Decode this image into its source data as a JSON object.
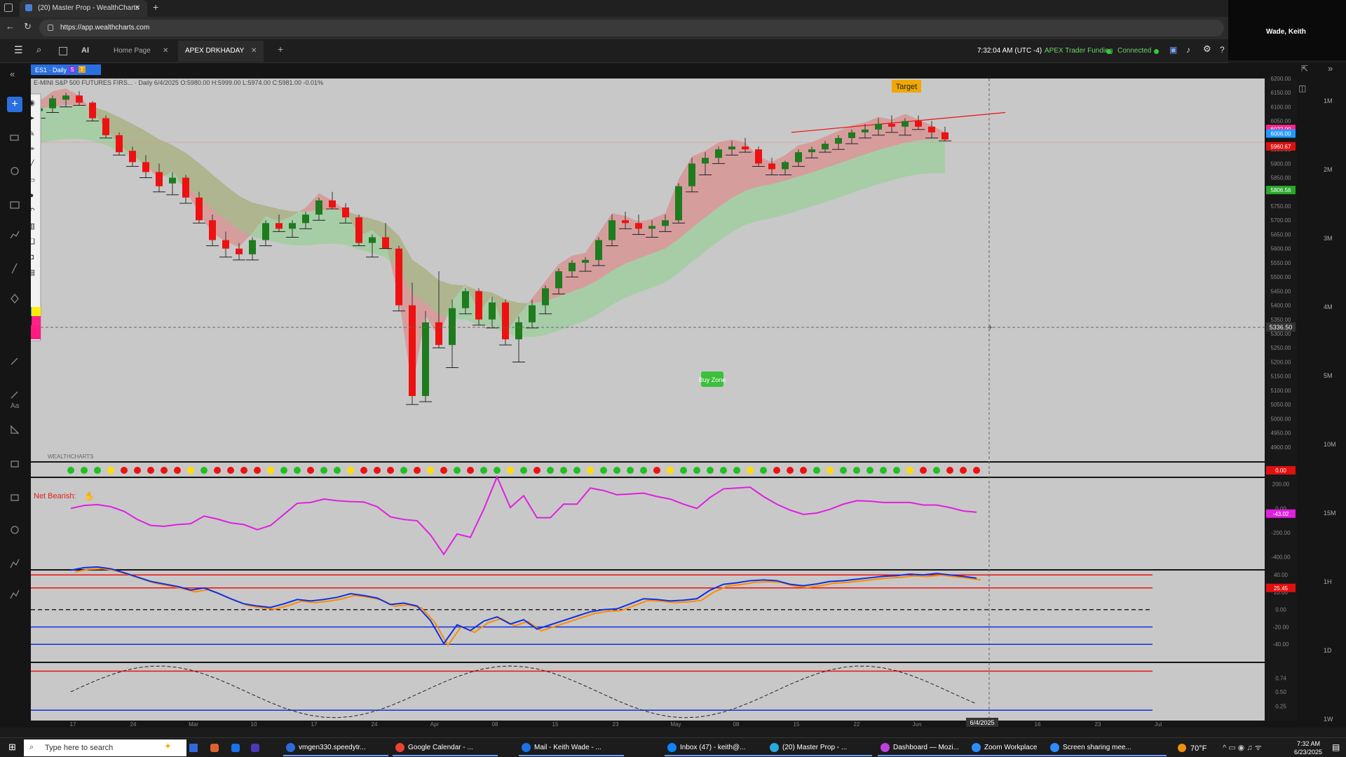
{
  "browser": {
    "tab_title": "(20) Master Prop - WealthCharts",
    "url": "https://app.wealthcharts.com",
    "new_tab": "+",
    "close": "✕"
  },
  "user": {
    "name": "Wade, Keith"
  },
  "app": {
    "tabs": [
      {
        "label": "Home Page"
      },
      {
        "label": "APEX DRKHADAY"
      }
    ],
    "add_tab": "+",
    "ai_label": "AI",
    "clock": "7:32:04 AM  (UTC -4)",
    "account": "APEX Trader Funding",
    "status": "Connected"
  },
  "chart": {
    "symbol_badge": "ES1 · Daily",
    "symbol_badge_items": [
      "S",
      "T"
    ],
    "ohlc_line": "E-MINI S&P 500 FUTURES FIRS... · Daily 6/4/2025 O:5980.00 H:5999.00 L:5974.00 C:5981.00 -0.01%",
    "target_label": "Target",
    "buy_zone_label": "Buy Zone",
    "watermark": "WEALTHCHARTS",
    "net_bearish_label": "Net Bearish:",
    "crosshair_date": "6/4/2025",
    "crosshair_price": "5336.50"
  },
  "chart_data": {
    "type": "candlestick",
    "ylim": [
      4850,
      6200
    ],
    "y_ticks": [
      6200,
      6150,
      6100,
      6050,
      6000,
      5950,
      5900,
      5850,
      5800,
      5750,
      5700,
      5650,
      5600,
      5550,
      5500,
      5450,
      5400,
      5350,
      5300,
      5250,
      5200,
      5150,
      5100,
      5050,
      5000,
      4950,
      4900
    ],
    "x_tick_labels": [
      "17",
      "24",
      "Mar",
      "10",
      "17",
      "24",
      "Apr",
      "08",
      "15",
      "23",
      "May",
      "08",
      "15",
      "22",
      "Jun",
      "09",
      "16",
      "23",
      "Jul"
    ],
    "price_labels": [
      {
        "value": "6022.00"
      },
      {
        "value": "6006.00"
      },
      {
        "value": "5960.67"
      },
      {
        "value": "5806.56"
      }
    ],
    "candles": [
      [
        6085,
        6110,
        6060,
        6095
      ],
      [
        6095,
        6140,
        6080,
        6130
      ],
      [
        6125,
        6150,
        6100,
        6140
      ],
      [
        6140,
        6155,
        6105,
        6115
      ],
      [
        6115,
        6120,
        6050,
        6060
      ],
      [
        6060,
        6070,
        5990,
        6000
      ],
      [
        6000,
        6010,
        5930,
        5940
      ],
      [
        5945,
        5960,
        5890,
        5905
      ],
      [
        5905,
        5930,
        5850,
        5870
      ],
      [
        5870,
        5900,
        5800,
        5820
      ],
      [
        5830,
        5870,
        5790,
        5850
      ],
      [
        5850,
        5860,
        5760,
        5780
      ],
      [
        5780,
        5800,
        5690,
        5700
      ],
      [
        5700,
        5720,
        5610,
        5630
      ],
      [
        5630,
        5660,
        5570,
        5600
      ],
      [
        5600,
        5620,
        5560,
        5580
      ],
      [
        5580,
        5640,
        5560,
        5630
      ],
      [
        5630,
        5700,
        5610,
        5690
      ],
      [
        5690,
        5720,
        5660,
        5670
      ],
      [
        5670,
        5700,
        5640,
        5690
      ],
      [
        5690,
        5730,
        5670,
        5720
      ],
      [
        5720,
        5780,
        5700,
        5770
      ],
      [
        5770,
        5800,
        5740,
        5745
      ],
      [
        5745,
        5760,
        5690,
        5710
      ],
      [
        5710,
        5720,
        5610,
        5620
      ],
      [
        5620,
        5650,
        5570,
        5640
      ],
      [
        5640,
        5690,
        5600,
        5600
      ],
      [
        5600,
        5610,
        5380,
        5400
      ],
      [
        5400,
        5480,
        5050,
        5080
      ],
      [
        5080,
        5380,
        5060,
        5340
      ],
      [
        5340,
        5520,
        5250,
        5260
      ],
      [
        5260,
        5420,
        5180,
        5390
      ],
      [
        5390,
        5460,
        5370,
        5450
      ],
      [
        5450,
        5460,
        5330,
        5350
      ],
      [
        5350,
        5430,
        5320,
        5410
      ],
      [
        5410,
        5420,
        5260,
        5280
      ],
      [
        5280,
        5360,
        5200,
        5340
      ],
      [
        5340,
        5420,
        5320,
        5400
      ],
      [
        5400,
        5470,
        5370,
        5460
      ],
      [
        5460,
        5530,
        5440,
        5520
      ],
      [
        5520,
        5560,
        5500,
        5550
      ],
      [
        5550,
        5570,
        5520,
        5560
      ],
      [
        5560,
        5640,
        5540,
        5630
      ],
      [
        5630,
        5720,
        5610,
        5700
      ],
      [
        5700,
        5730,
        5670,
        5690
      ],
      [
        5690,
        5720,
        5650,
        5670
      ],
      [
        5670,
        5700,
        5640,
        5680
      ],
      [
        5680,
        5720,
        5660,
        5700
      ],
      [
        5700,
        5830,
        5690,
        5820
      ],
      [
        5820,
        5920,
        5800,
        5900
      ],
      [
        5900,
        5940,
        5860,
        5920
      ],
      [
        5920,
        5960,
        5900,
        5950
      ],
      [
        5950,
        5980,
        5930,
        5960
      ],
      [
        5960,
        5990,
        5940,
        5950
      ],
      [
        5950,
        5960,
        5890,
        5900
      ],
      [
        5900,
        5920,
        5860,
        5880
      ],
      [
        5880,
        5910,
        5860,
        5905
      ],
      [
        5905,
        5950,
        5890,
        5940
      ],
      [
        5940,
        5960,
        5920,
        5950
      ],
      [
        5950,
        5980,
        5940,
        5970
      ],
      [
        5970,
        6000,
        5950,
        5990
      ],
      [
        5990,
        6020,
        5970,
        6010
      ],
      [
        6010,
        6040,
        5990,
        6020
      ],
      [
        6020,
        6060,
        6000,
        6040
      ],
      [
        6040,
        6070,
        6010,
        6030
      ],
      [
        6030,
        6060,
        6000,
        6050
      ],
      [
        6050,
        6070,
        6020,
        6030
      ],
      [
        6030,
        6050,
        5990,
        6010
      ],
      [
        6010,
        6030,
        5980,
        5985
      ]
    ],
    "oscillator": {
      "ylim": [
        -500,
        250
      ],
      "y_ticks": [
        "200.00",
        "0.00",
        "-200.00",
        "-400.00"
      ],
      "current": "-43.02"
    },
    "stoch": {
      "ylim": [
        -60,
        45
      ],
      "y_ticks": [
        "40.00",
        "20.00",
        "0.00",
        "-20.00",
        "-40.00"
      ],
      "current": "25.45"
    },
    "cycle": {
      "ylim": [
        0,
        1
      ],
      "y_ticks": [
        "0.74",
        "0.50",
        "0.25"
      ],
      "current": "0.74"
    },
    "dots_value": "0.00"
  },
  "drawing_tools": [
    "eye-icon",
    "cursor-icon",
    "brush-icon",
    "pencil-icon",
    "line-icon",
    "ruler-icon",
    "dot-icon",
    "undo-icon",
    "trash-icon",
    "layers-icon",
    "camera-icon",
    "clipboard-icon"
  ],
  "right_timeframes": [
    "1M",
    "2M",
    "3M",
    "4M",
    "5M",
    "10M",
    "15M",
    "1H",
    "1D",
    "1W"
  ],
  "taskbar": {
    "search_placeholder": "Type here to search",
    "items": [
      {
        "label": "vmgen330.speedytr..."
      },
      {
        "label": "Google Calendar - ..."
      },
      {
        "label": "Mail - Keith Wade - ..."
      },
      {
        "label": "Inbox (47) - keith@..."
      },
      {
        "label": "(20) Master Prop - ..."
      },
      {
        "label": "Dashboard — Mozi..."
      },
      {
        "label": "Zoom Workplace"
      },
      {
        "label": "Screen sharing mee..."
      }
    ],
    "weather": "70°F",
    "time": "7:32 AM",
    "date": "6/23/2025"
  },
  "colors": {
    "bull": "#1e7b1e",
    "bear": "#ee1111",
    "osc": "#e020e0",
    "blue": "#1030e0",
    "orange": "#ff8c00",
    "bg": "#c9c9c9"
  }
}
